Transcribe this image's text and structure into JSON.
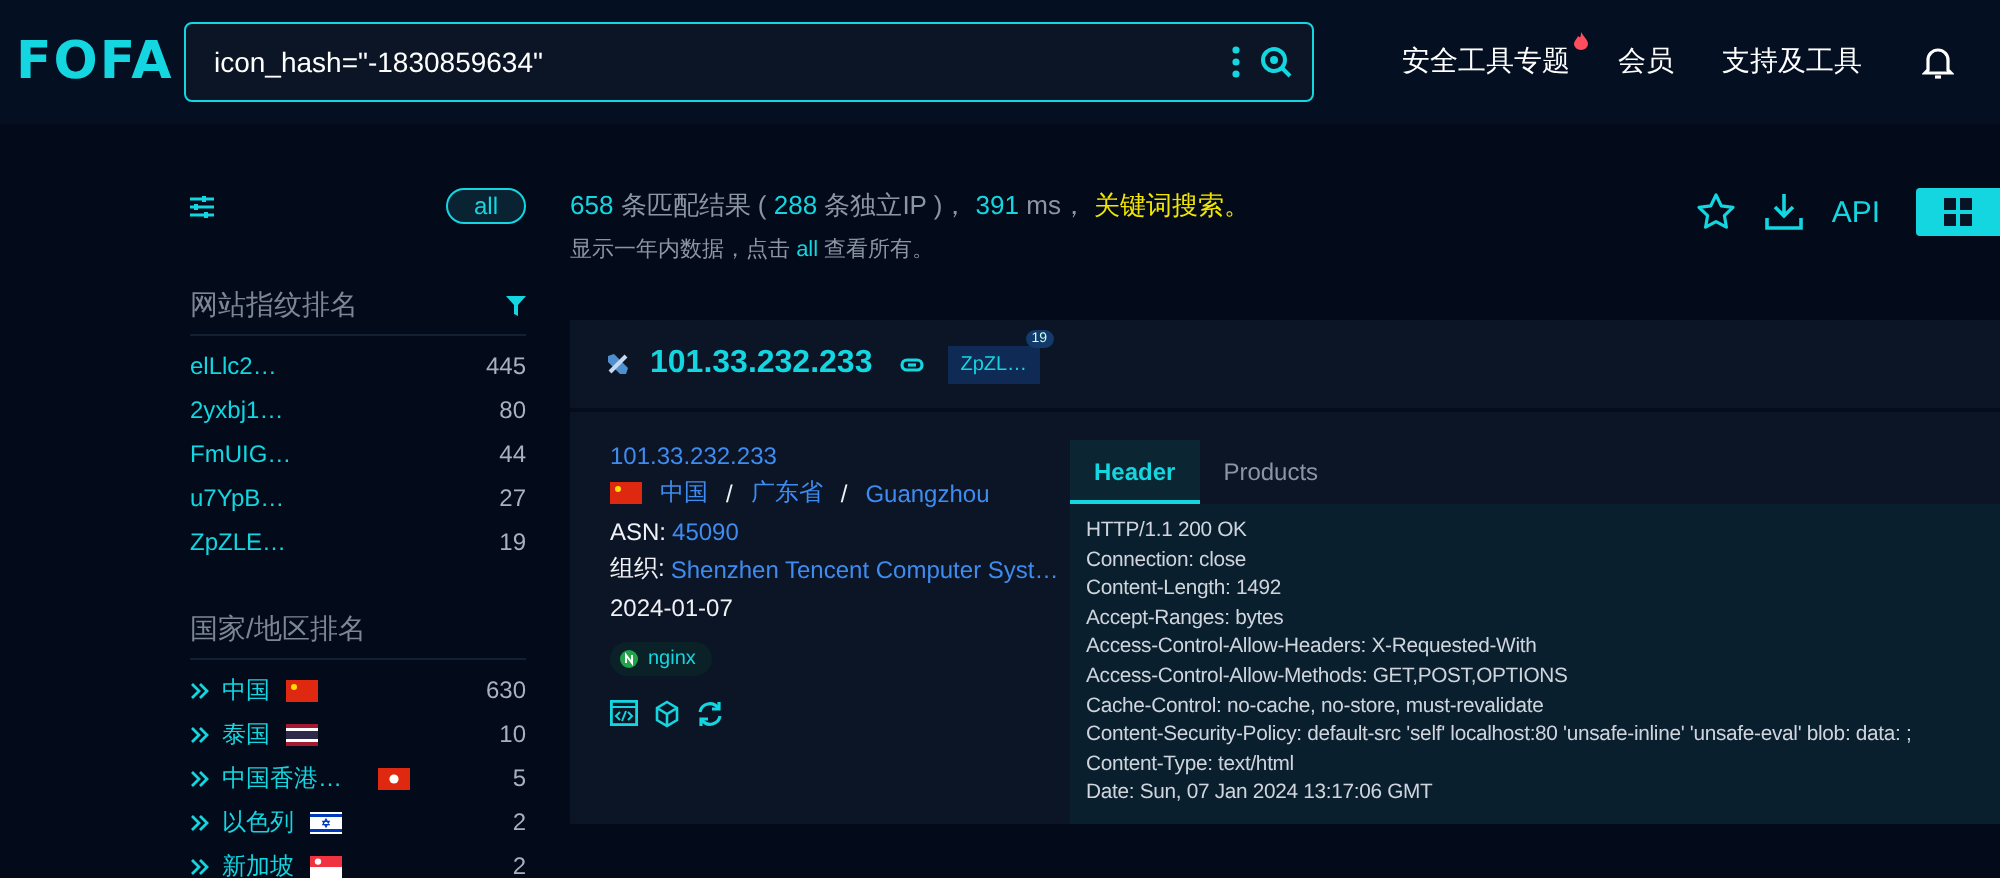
{
  "logo": {
    "text": "FOFA"
  },
  "search": {
    "value": "icon_hash=\"-1830859634\""
  },
  "nav": [
    {
      "label": "安全工具专题",
      "hot": true
    },
    {
      "label": "会员",
      "hot": false
    },
    {
      "label": "支持及工具",
      "hot": false
    }
  ],
  "sidebar": {
    "filter_button": "all",
    "fingerprint_ranking": {
      "title": "网站指纹排名",
      "items": [
        {
          "label": "elLlc2…",
          "count": "445"
        },
        {
          "label": "2yxbj1…",
          "count": "80"
        },
        {
          "label": "FmUIG…",
          "count": "44"
        },
        {
          "label": "u7YpB…",
          "count": "27"
        },
        {
          "label": "ZpZLE…",
          "count": "19"
        }
      ]
    },
    "country_ranking": {
      "title": "国家/地区排名",
      "items": [
        {
          "label": "中国",
          "count": "630",
          "kind": "cn"
        },
        {
          "label": "泰国",
          "count": "10",
          "kind": "th"
        },
        {
          "label": "中国香港…",
          "count": "5",
          "kind": "hk"
        },
        {
          "label": "以色列",
          "count": "2",
          "kind": "il"
        },
        {
          "label": "新加坡",
          "count": "2",
          "kind": "sg"
        }
      ]
    }
  },
  "summary": {
    "line_1": [
      {
        "kind": "number",
        "text": "658"
      },
      {
        "kind": "text",
        "text": " 条匹配结果 ( "
      },
      {
        "kind": "number",
        "text": "288"
      },
      {
        "kind": "text",
        "text": " 条独立IP )， "
      },
      {
        "kind": "number",
        "text": "391"
      },
      {
        "kind": "text",
        "text": " ms， "
      },
      {
        "kind": "keyword",
        "text": "关键词搜索。"
      }
    ],
    "line_2": [
      {
        "kind": "text",
        "text": "显示一年内数据，点击 "
      },
      {
        "kind": "number",
        "text": "all"
      },
      {
        "kind": "text",
        "text": " 查看所有。"
      }
    ]
  },
  "toolbar": {
    "api": "API",
    "grid_view": {
      "selected": true
    }
  },
  "result": {
    "ip": "101.33.232.233",
    "tag": {
      "label": "ZpZL…",
      "count": "19"
    },
    "link": "101.33.232.233",
    "flag": {
      "kind": "cn"
    },
    "location": [
      {
        "kind": "place",
        "text": "中国"
      },
      {
        "kind": "separator",
        "text": "/"
      },
      {
        "kind": "place",
        "text": "广东省"
      },
      {
        "kind": "separator",
        "text": "/"
      },
      {
        "kind": "place",
        "text": "Guangzhou"
      }
    ],
    "asn_label": "ASN:",
    "asn": "45090",
    "org_label": "组织:",
    "org": "Shenzhen Tencent Computer Syst…",
    "date": "2024-01-07",
    "product": "nginx",
    "tabs": [
      {
        "label": "Header",
        "selected": true
      },
      {
        "label": "Products",
        "selected": false
      }
    ],
    "header_lines": [
      "HTTP/1.1 200 OK",
      "Connection: close",
      "Content-Length: 1492",
      "Accept-Ranges: bytes",
      "Access-Control-Allow-Headers: X-Requested-With",
      "Access-Control-Allow-Methods: GET,POST,OPTIONS",
      "Cache-Control: no-cache, no-store, must-revalidate",
      "Content-Security-Policy: default-src 'self' localhost:80 'unsafe-inline' 'unsafe-eval' blob: data: ;",
      "Content-Type: text/html",
      "Date: Sun, 07 Jan 2024 13:17:06 GMT"
    ]
  }
}
